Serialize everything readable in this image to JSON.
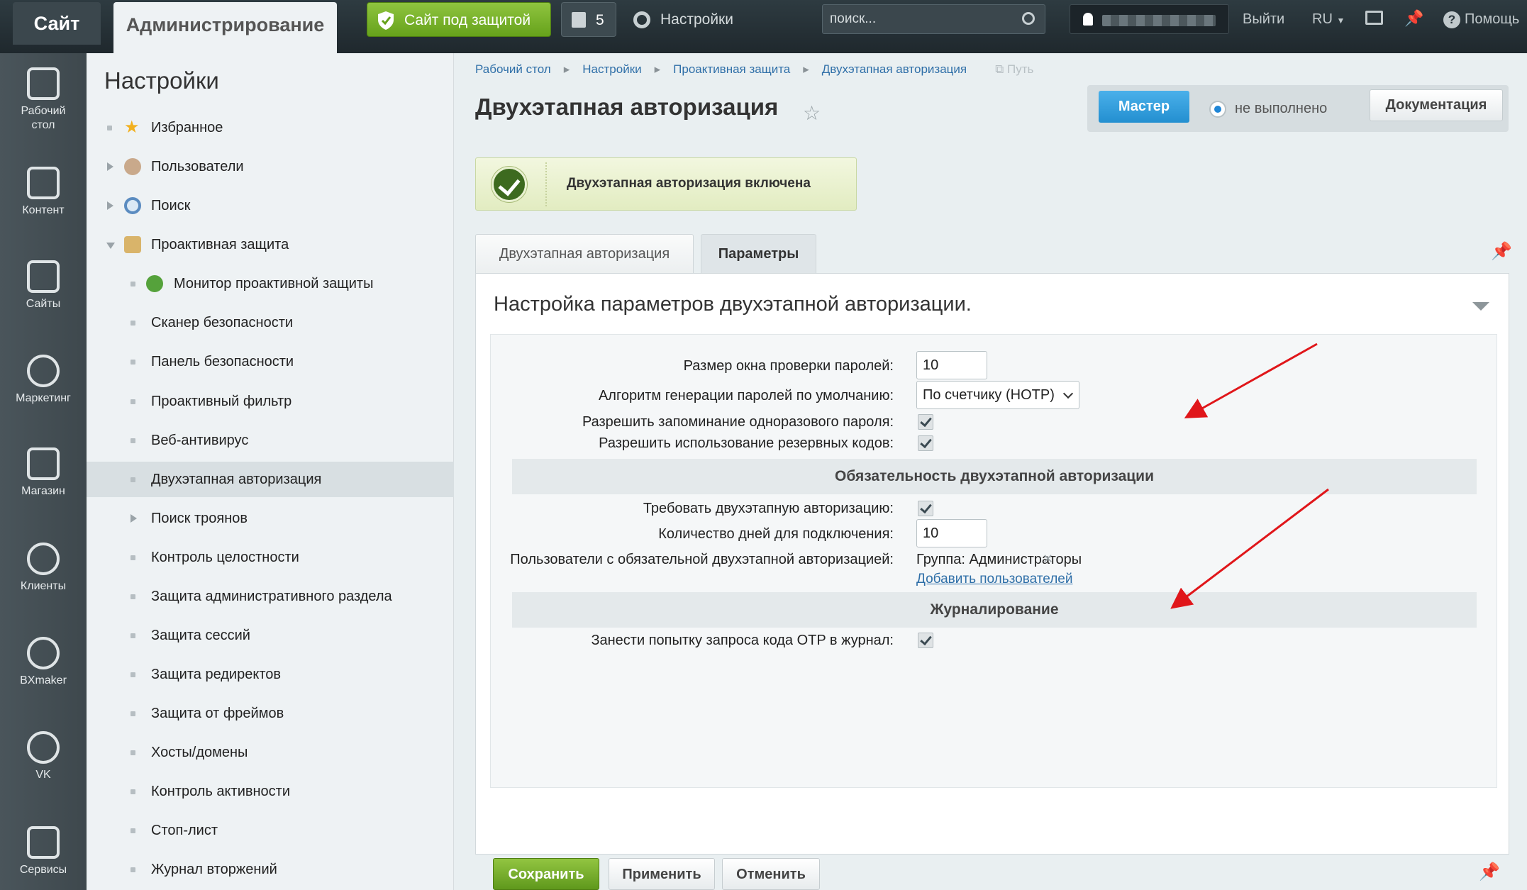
{
  "topbar": {
    "site_tab": "Сайт",
    "admin_tab": "Администрирование",
    "protect_label": "Сайт под защитой",
    "notif_count": "5",
    "settings_label": "Настройки",
    "search_placeholder": "поиск...",
    "logout": "Выйти",
    "lang": "RU",
    "help": "Помощь"
  },
  "leftnav": [
    {
      "l1": "Рабочий",
      "l2": "стол",
      "icon": "home-icon"
    },
    {
      "l1": "Контент",
      "l2": "",
      "icon": "content-icon"
    },
    {
      "l1": "Сайты",
      "l2": "",
      "icon": "calendar-24-icon"
    },
    {
      "l1": "Маркетинг",
      "l2": "",
      "icon": "target-icon"
    },
    {
      "l1": "Магазин",
      "l2": "",
      "icon": "basket-icon"
    },
    {
      "l1": "Клиенты",
      "l2": "",
      "icon": "clients-24-icon"
    },
    {
      "l1": "BXmaker",
      "l2": "",
      "icon": "arrow-circle-icon"
    },
    {
      "l1": "VK",
      "l2": "",
      "icon": "arrow-circle-icon"
    },
    {
      "l1": "Сервисы",
      "l2": "",
      "icon": "layers-icon"
    }
  ],
  "sidebar": {
    "title": "Настройки",
    "items": [
      {
        "label": "Избранное"
      },
      {
        "label": "Пользователи"
      },
      {
        "label": "Поиск"
      },
      {
        "label": "Проактивная защита"
      },
      {
        "label": "Монитор проактивной защиты"
      },
      {
        "label": "Сканер безопасности"
      },
      {
        "label": "Панель безопасности"
      },
      {
        "label": "Проактивный фильтр"
      },
      {
        "label": "Веб-антивирус"
      },
      {
        "label": "Двухэтапная авторизация"
      },
      {
        "label": "Поиск троянов"
      },
      {
        "label": "Контроль целостности"
      },
      {
        "label": "Защита административного раздела"
      },
      {
        "label": "Защита сессий"
      },
      {
        "label": "Защита редиректов"
      },
      {
        "label": "Защита от фреймов"
      },
      {
        "label": "Хосты/домены"
      },
      {
        "label": "Контроль активности"
      },
      {
        "label": "Стоп-лист"
      },
      {
        "label": "Журнал вторжений"
      }
    ]
  },
  "breadcrumb": [
    "Рабочий стол",
    "Настройки",
    "Проактивная защита",
    "Двухэтапная авторизация"
  ],
  "path_label": "Путь",
  "page_title": "Двухэтапная авторизация",
  "master": {
    "button": "Мастер",
    "status": "не выполнено",
    "doc_button": "Документация"
  },
  "notice": "Двухэтапная авторизация включена",
  "tabs": [
    {
      "label": "Двухэтапная авторизация"
    },
    {
      "label": "Параметры"
    }
  ],
  "panel": {
    "title": "Настройка параметров двухэтапной авторизации.",
    "fields": {
      "window_label": "Размер окна проверки паролей:",
      "window_value": "10",
      "algo_label": "Алгоритм генерации паролей по умолчанию:",
      "algo_value": "По счетчику (HOTP)",
      "remember_label": "Разрешить запоминание одноразового пароля:",
      "backup_label": "Разрешить использование резервных кодов:",
      "section_required": "Обязательность двухэтапной авторизации",
      "require_label": "Требовать двухэтапную авторизацию:",
      "days_label": "Количество дней для подключения:",
      "days_value": "10",
      "users_label": "Пользователи с обязательной двухэтапной авторизацией:",
      "group_value": "Группа: Администраторы",
      "add_users": "Добавить пользователей",
      "section_log": "Журналирование",
      "log_label": "Занести попытку запроса кода OTP в журнал:"
    }
  },
  "buttons": {
    "save": "Сохранить",
    "apply": "Применить",
    "cancel": "Отменить"
  },
  "colors": {
    "accent_green": "#66a21b",
    "accent_blue": "#238fd0",
    "arrow_red": "#e0161a"
  }
}
